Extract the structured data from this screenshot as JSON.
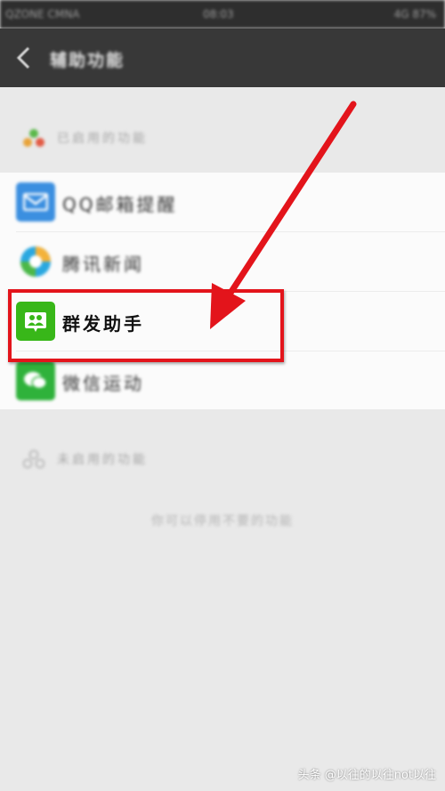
{
  "status_bar": {
    "carrier": "QZONE CMNA",
    "time": "08:03",
    "indicators": "4G 87%"
  },
  "header": {
    "title": "辅助功能",
    "back_icon": "chevron-left-icon"
  },
  "enabled_section": {
    "label": "已启用的功能"
  },
  "features": [
    {
      "label": "QQ邮箱提醒",
      "icon": "envelope-icon",
      "color": "#3b8fe0"
    },
    {
      "label": "腾讯新闻",
      "icon": "news-icon",
      "color": "#2aa8e0"
    },
    {
      "label": "群发助手",
      "icon": "group-icon",
      "color": "#38b719"
    },
    {
      "label": "微信运动",
      "icon": "wechat-icon",
      "color": "#2fb23b"
    }
  ],
  "disabled_section": {
    "label": "未启用的功能",
    "empty_hint": "你可以停用不要的功能"
  },
  "annotation": {
    "color": "#e3141b"
  },
  "watermark": "头条 @以往的以往not以往"
}
